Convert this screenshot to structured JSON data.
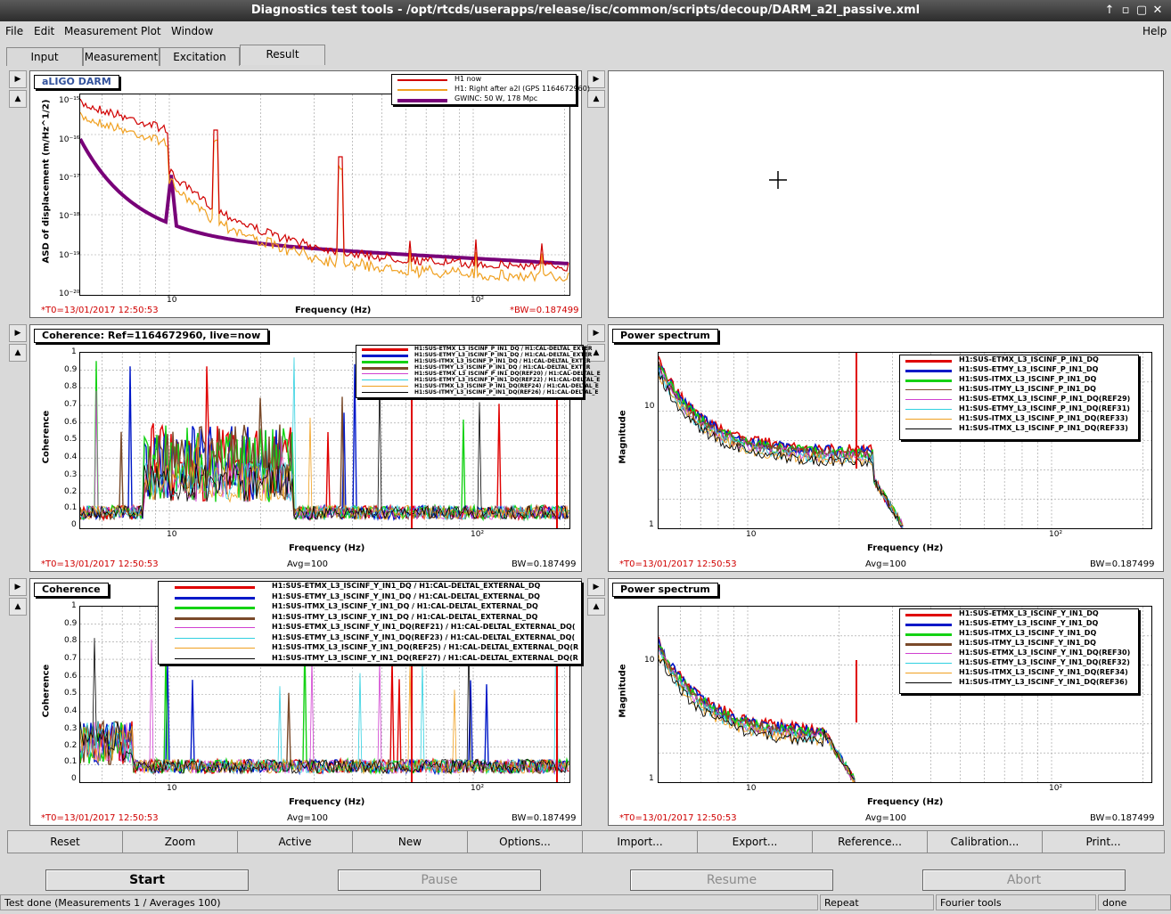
{
  "window": {
    "title": "Diagnostics test tools - /opt/rtcds/userapps/release/isc/common/scripts/decoup/DARM_a2l_passive.xml",
    "btn_up": "↑",
    "btn_min": "▫",
    "btn_max": "▢",
    "btn_close": "✕"
  },
  "menu": {
    "file": "File",
    "edit": "Edit",
    "measurement": "Measurement",
    "plot": "Plot",
    "window": "Window",
    "help": "Help"
  },
  "tabs": [
    "Input",
    "Measurement",
    "Excitation",
    "Result"
  ],
  "pane_arrows": {
    "right": "▶",
    "up": "▲"
  },
  "panels": {
    "darm": {
      "title": "aLIGO DARM",
      "ylabel": "ASD of displacement (m/Hz^1/2)",
      "xlabel": "Frequency (Hz)",
      "ticks_y": [
        "10⁻¹⁵",
        "10⁻¹⁶",
        "10⁻¹⁷",
        "10⁻¹⁸",
        "10⁻¹⁹",
        "10⁻²⁰"
      ],
      "ticks_x": [
        "10",
        "10²"
      ],
      "legend": [
        "H1 now",
        "H1: Right after a2l (GPS 1164672960)",
        "GWINC: 50 W, 178 Mpc"
      ],
      "t0": "*T0=13/01/2017 12:50:53",
      "bw": "*BW=0.187499"
    },
    "coh_p": {
      "title": "Coherence: Ref=1164672960, live=now",
      "ylabel": "Coherence",
      "xlabel": "Frequency (Hz)",
      "ticks_y": [
        "1",
        "0.9",
        "0.8",
        "0.7",
        "0.6",
        "0.5",
        "0.4",
        "0.3",
        "0.2",
        "0.1",
        "0"
      ],
      "ticks_x": [
        "10",
        "10²"
      ],
      "legend": [
        "H1:SUS-ETMX_L3_ISCINF_P_IN1_DQ / H1:CAL-DELTAL_EXTER",
        "H1:SUS-ETMY_L3_ISCINF_P_IN1_DQ / H1:CAL-DELTAL_EXTER",
        "H1:SUS-ITMX_L3_ISCINF_P_IN1_DQ / H1:CAL-DELTAL_EXTER",
        "H1:SUS-ITMY_L3_ISCINF_P_IN1_DQ / H1:CAL-DELTAL_EXTER",
        "H1:SUS-ETMX_L3_ISCINF_P_IN1_DQ(REF20) / H1:CAL-DELTAL_E",
        "H1:SUS-ETMY_L3_ISCINF_P_IN1_DQ(REF22) / H1:CAL-DELTAL_E",
        "H1:SUS-ITMX_L3_ISCINF_P_IN1_DQ(REF24) / H1:CAL-DELTAL_E",
        "H1:SUS-ITMY_L3_ISCINF_P_IN1_DQ(REF26) / H1:CAL-DELTAL_E"
      ],
      "t0": "*T0=13/01/2017 12:50:53",
      "avg": "Avg=100",
      "bw": "BW=0.187499"
    },
    "ps_p": {
      "title": "Power spectrum",
      "ylabel": "Magnitude",
      "xlabel": "Frequency (Hz)",
      "ticks_y": [
        "10",
        "1"
      ],
      "ticks_x": [
        "10",
        "10²"
      ],
      "legend": [
        "H1:SUS-ETMX_L3_ISCINF_P_IN1_DQ",
        "H1:SUS-ETMY_L3_ISCINF_P_IN1_DQ",
        "H1:SUS-ITMX_L3_ISCINF_P_IN1_DQ",
        "H1:SUS-ITMY_L3_ISCINF_P_IN1_DQ",
        "H1:SUS-ETMX_L3_ISCINF_P_IN1_DQ(REF29)",
        "H1:SUS-ETMY_L3_ISCINF_P_IN1_DQ(REF31)",
        "H1:SUS-ITMX_L3_ISCINF_P_IN1_DQ(REF33)",
        "H1:SUS-ITMX_L3_ISCINF_P_IN1_DQ(REF33)"
      ],
      "t0": "*T0=13/01/2017 12:50:53",
      "avg": "Avg=100",
      "bw": "BW=0.187499"
    },
    "coh_y": {
      "title": "Coherence",
      "ylabel": "Coherence",
      "xlabel": "Frequency (Hz)",
      "ticks_y": [
        "1",
        "0.9",
        "0.8",
        "0.7",
        "0.6",
        "0.5",
        "0.4",
        "0.3",
        "0.2",
        "0.1",
        "0"
      ],
      "ticks_x": [
        "10",
        "10²"
      ],
      "legend": [
        "H1:SUS-ETMX_L3_ISCINF_Y_IN1_DQ / H1:CAL-DELTAL_EXTERNAL_DQ",
        "H1:SUS-ETMY_L3_ISCINF_Y_IN1_DQ / H1:CAL-DELTAL_EXTERNAL_DQ",
        "H1:SUS-ITMX_L3_ISCINF_Y_IN1_DQ / H1:CAL-DELTAL_EXTERNAL_DQ",
        "H1:SUS-ITMY_L3_ISCINF_Y_IN1_DQ / H1:CAL-DELTAL_EXTERNAL_DQ",
        "H1:SUS-ETMX_L3_ISCINF_Y_IN1_DQ(REF21) / H1:CAL-DELTAL_EXTERNAL_DQ(",
        "H1:SUS-ETMY_L3_ISCINF_Y_IN1_DQ(REF23) / H1:CAL-DELTAL_EXTERNAL_DQ(",
        "H1:SUS-ITMX_L3_ISCINF_Y_IN1_DQ(REF25) / H1:CAL-DELTAL_EXTERNAL_DQ(R",
        "H1:SUS-ITMY_L3_ISCINF_Y_IN1_DQ(REF27) / H1:CAL-DELTAL_EXTERNAL_DQ(R"
      ],
      "t0": "*T0=13/01/2017 12:50:53",
      "avg": "Avg=100",
      "bw": "BW=0.187499"
    },
    "ps_y": {
      "title": "Power spectrum",
      "ylabel": "Magnitude",
      "xlabel": "Frequency (Hz)",
      "ticks_y": [
        "10",
        "1"
      ],
      "ticks_x": [
        "10",
        "10²"
      ],
      "legend": [
        "H1:SUS-ETMX_L3_ISCINF_Y_IN1_DQ",
        "H1:SUS-ETMY_L3_ISCINF_Y_IN1_DQ",
        "H1:SUS-ITMX_L3_ISCINF_Y_IN1_DQ",
        "H1:SUS-ITMY_L3_ISCINF_Y_IN1_DQ",
        "H1:SUS-ETMX_L3_ISCINF_Y_IN1_DQ(REF30)",
        "H1:SUS-ETMY_L3_ISCINF_Y_IN1_DQ(REF32)",
        "H1:SUS-ITMX_L3_ISCINF_Y_IN1_DQ(REF34)",
        "H1:SUS-ITMY_L3_ISCINF_Y_IN1_DQ(REF36)"
      ],
      "t0": "*T0=13/01/2017 12:50:53",
      "avg": "Avg=100",
      "bw": "BW=0.187499"
    }
  },
  "colors": {
    "series": [
      "#e00000",
      "#0018c8",
      "#14d214",
      "#7a4a2a",
      "#d040d0",
      "#30d0e0",
      "#f0a020",
      "#000000"
    ],
    "darm": [
      "#d00000",
      "#f0a020",
      "#780078"
    ]
  },
  "result_buttons": [
    "Reset",
    "Zoom",
    "Active",
    "New",
    "Options...",
    "Import...",
    "Export...",
    "Reference...",
    "Calibration...",
    "Print..."
  ],
  "controls": {
    "start": "Start",
    "pause": "Pause",
    "resume": "Resume",
    "abort": "Abort"
  },
  "status": {
    "message": "Test done (Measurements 1 / Averages 100)",
    "mode": "Repeat",
    "tool": "Fourier tools",
    "state": "done"
  }
}
